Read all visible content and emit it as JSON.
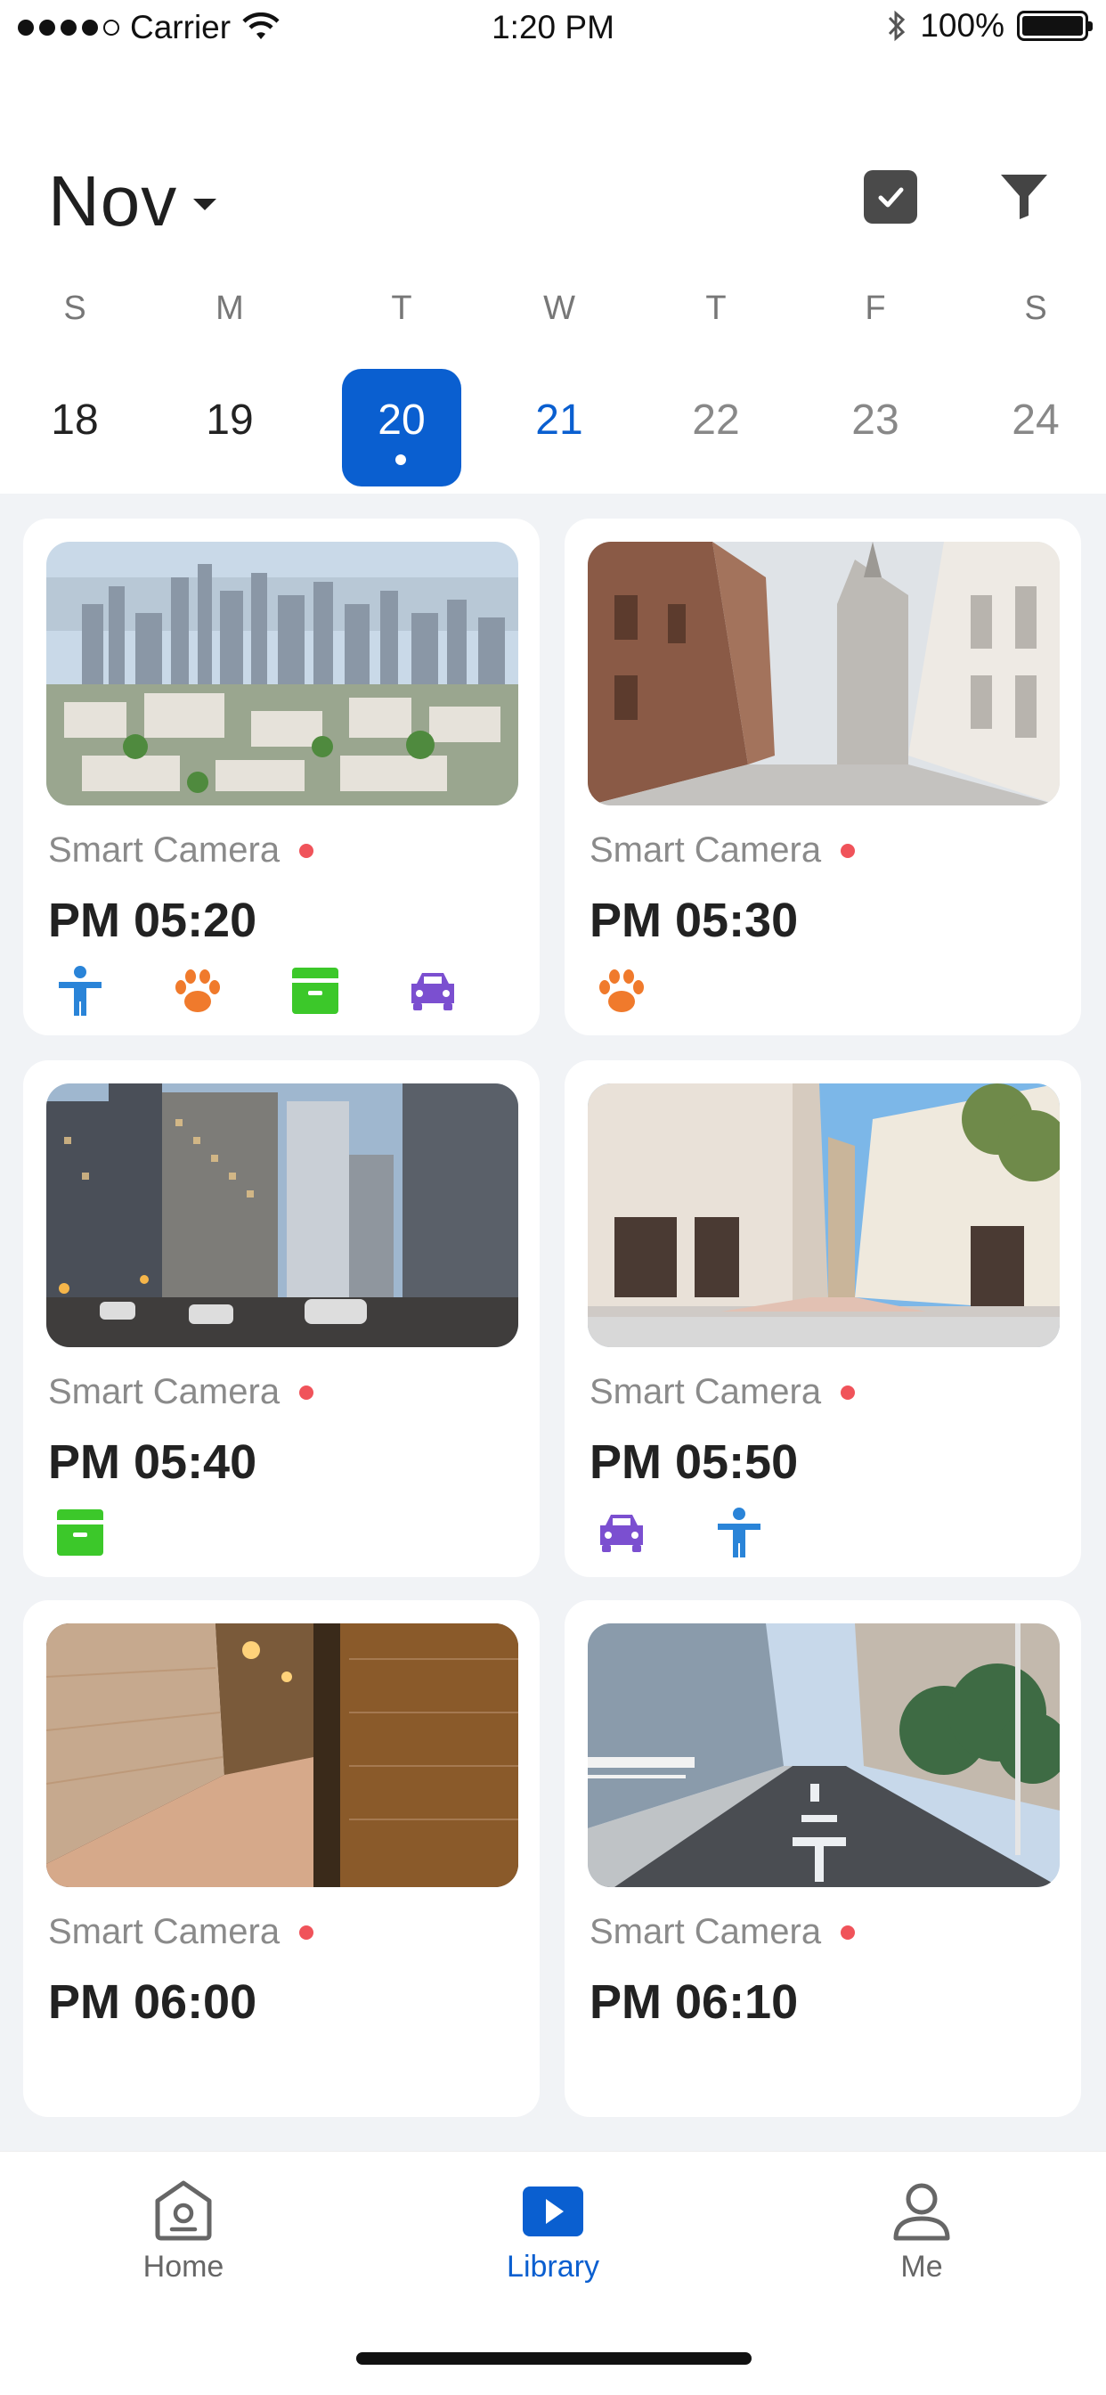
{
  "status_bar": {
    "carrier": "Carrier",
    "time": "1:20 PM",
    "battery": "100%",
    "bluetooth_icon": "bluetooth-icon",
    "wifi_icon": "wifi-icon"
  },
  "header": {
    "month": "Nov",
    "select_icon": "checkbox-icon",
    "filter_icon": "filter-icon"
  },
  "week": [
    {
      "letter": "S",
      "num": "18",
      "state": "past"
    },
    {
      "letter": "M",
      "num": "19",
      "state": "past"
    },
    {
      "letter": "T",
      "num": "20",
      "state": "selected"
    },
    {
      "letter": "W",
      "num": "21",
      "state": "accent"
    },
    {
      "letter": "T",
      "num": "22",
      "state": "future"
    },
    {
      "letter": "F",
      "num": "23",
      "state": "future"
    },
    {
      "letter": "S",
      "num": "24",
      "state": "future"
    }
  ],
  "cards": [
    {
      "camera": "Smart Camera",
      "time": "PM 05:20",
      "scene": "city-skyline",
      "tags": [
        "person-icon",
        "pet-paw-icon",
        "package-icon",
        "car-icon"
      ]
    },
    {
      "camera": "Smart Camera",
      "time": "PM 05:30",
      "scene": "old-street",
      "tags": [
        "pet-paw-icon"
      ]
    },
    {
      "camera": "Smart Camera",
      "time": "PM 05:40",
      "scene": "city-street",
      "tags": [
        "package-icon"
      ]
    },
    {
      "camera": "Smart Camera",
      "time": "PM 05:50",
      "scene": "sunny-street",
      "tags": [
        "car-icon",
        "person-icon"
      ]
    },
    {
      "camera": "Smart Camera",
      "time": "PM 06:00",
      "scene": "night-alley",
      "tags": []
    },
    {
      "camera": "Smart Camera",
      "time": "PM 06:10",
      "scene": "residential-road",
      "tags": []
    }
  ],
  "tabs": [
    {
      "label": "Home",
      "icon": "home-camera-icon",
      "active": false
    },
    {
      "label": "Library",
      "icon": "library-play-icon",
      "active": true
    },
    {
      "label": "Me",
      "icon": "profile-icon",
      "active": false
    }
  ],
  "colors": {
    "accent": "#0a5fd0",
    "record_dot": "#f0535a",
    "person": "#2a84d8",
    "pet": "#f07a2c",
    "package": "#3cc82a",
    "car": "#7b4fd0"
  }
}
